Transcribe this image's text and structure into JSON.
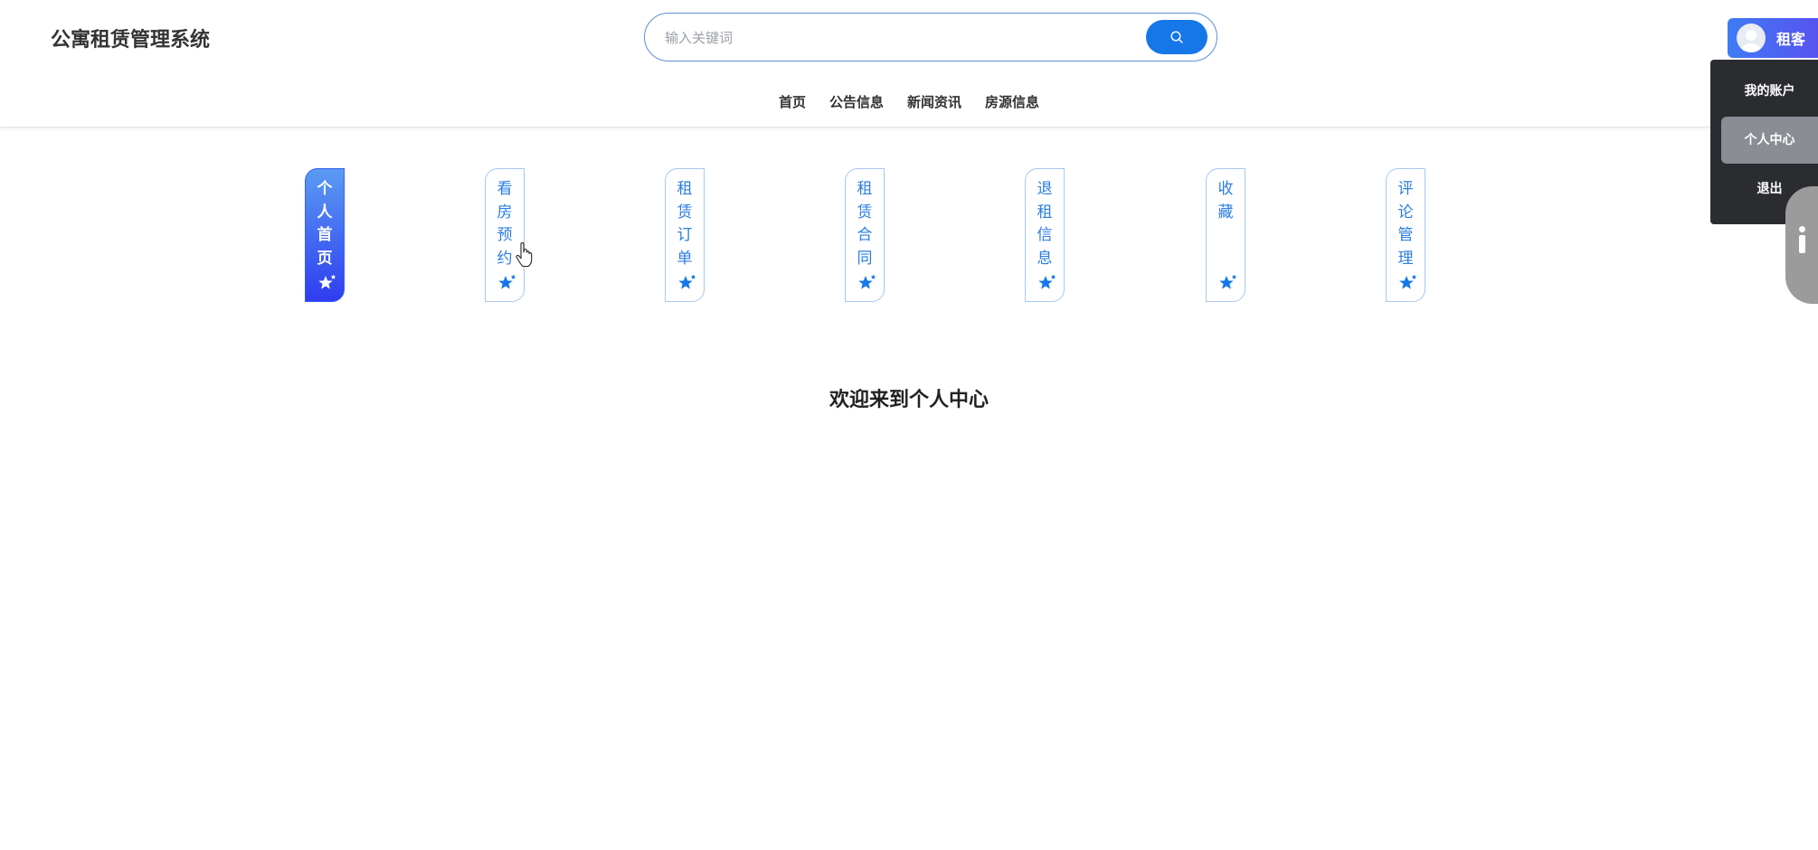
{
  "header": {
    "site_title": "公寓租赁管理系统",
    "search": {
      "placeholder": "输入关键词",
      "button_icon": "search-icon"
    },
    "nav": [
      {
        "label": "首页"
      },
      {
        "label": "公告信息"
      },
      {
        "label": "新闻资讯"
      },
      {
        "label": "房源信息"
      }
    ],
    "user": {
      "label": "租客",
      "avatar_icon": "avatar-icon"
    }
  },
  "user_menu": {
    "items": [
      {
        "label": "我的账户",
        "active": false
      },
      {
        "label": "个人中心",
        "active": true
      },
      {
        "label": "退出",
        "active": false
      }
    ]
  },
  "center_tabs": {
    "items": [
      {
        "label": "个人首页",
        "active": true
      },
      {
        "label": "看房预约",
        "active": false
      },
      {
        "label": "租赁订单",
        "active": false
      },
      {
        "label": "租赁合同",
        "active": false
      },
      {
        "label": "退租信息",
        "active": false
      },
      {
        "label": "收藏",
        "active": false
      },
      {
        "label": "评论管理",
        "active": false
      }
    ],
    "tab_icon": "star-icon"
  },
  "main": {
    "welcome_text": "欢迎来到个人中心"
  },
  "colors": {
    "accent_blue": "#1677e8",
    "tab_text_blue": "#2b7de3",
    "active_gradient_start": "#5a9bf3",
    "active_gradient_end": "#2f3df0",
    "dropdown_bg": "#2a2c30"
  }
}
